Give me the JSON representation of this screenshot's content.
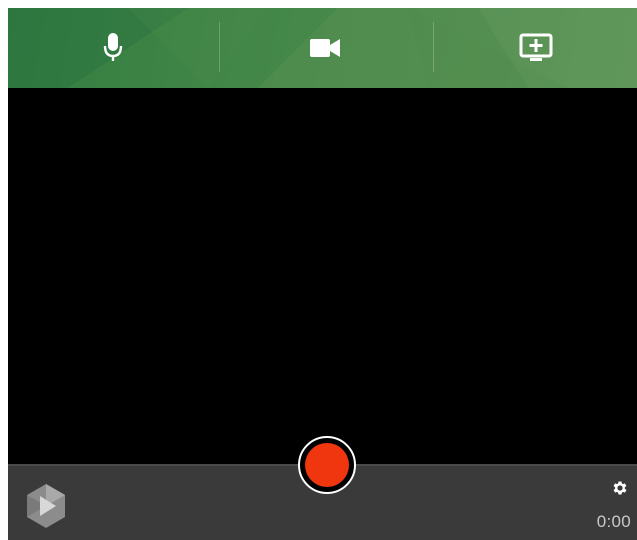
{
  "toolbar": {
    "buttons": [
      {
        "icon": "microphone-icon"
      },
      {
        "icon": "video-camera-icon"
      },
      {
        "icon": "add-screen-icon"
      }
    ]
  },
  "recorder": {
    "record_color": "#f0360e",
    "timer": "0:00"
  },
  "colors": {
    "toolbar_green": "#4a8a4c",
    "bottom_bar": "#3a3a3a"
  }
}
